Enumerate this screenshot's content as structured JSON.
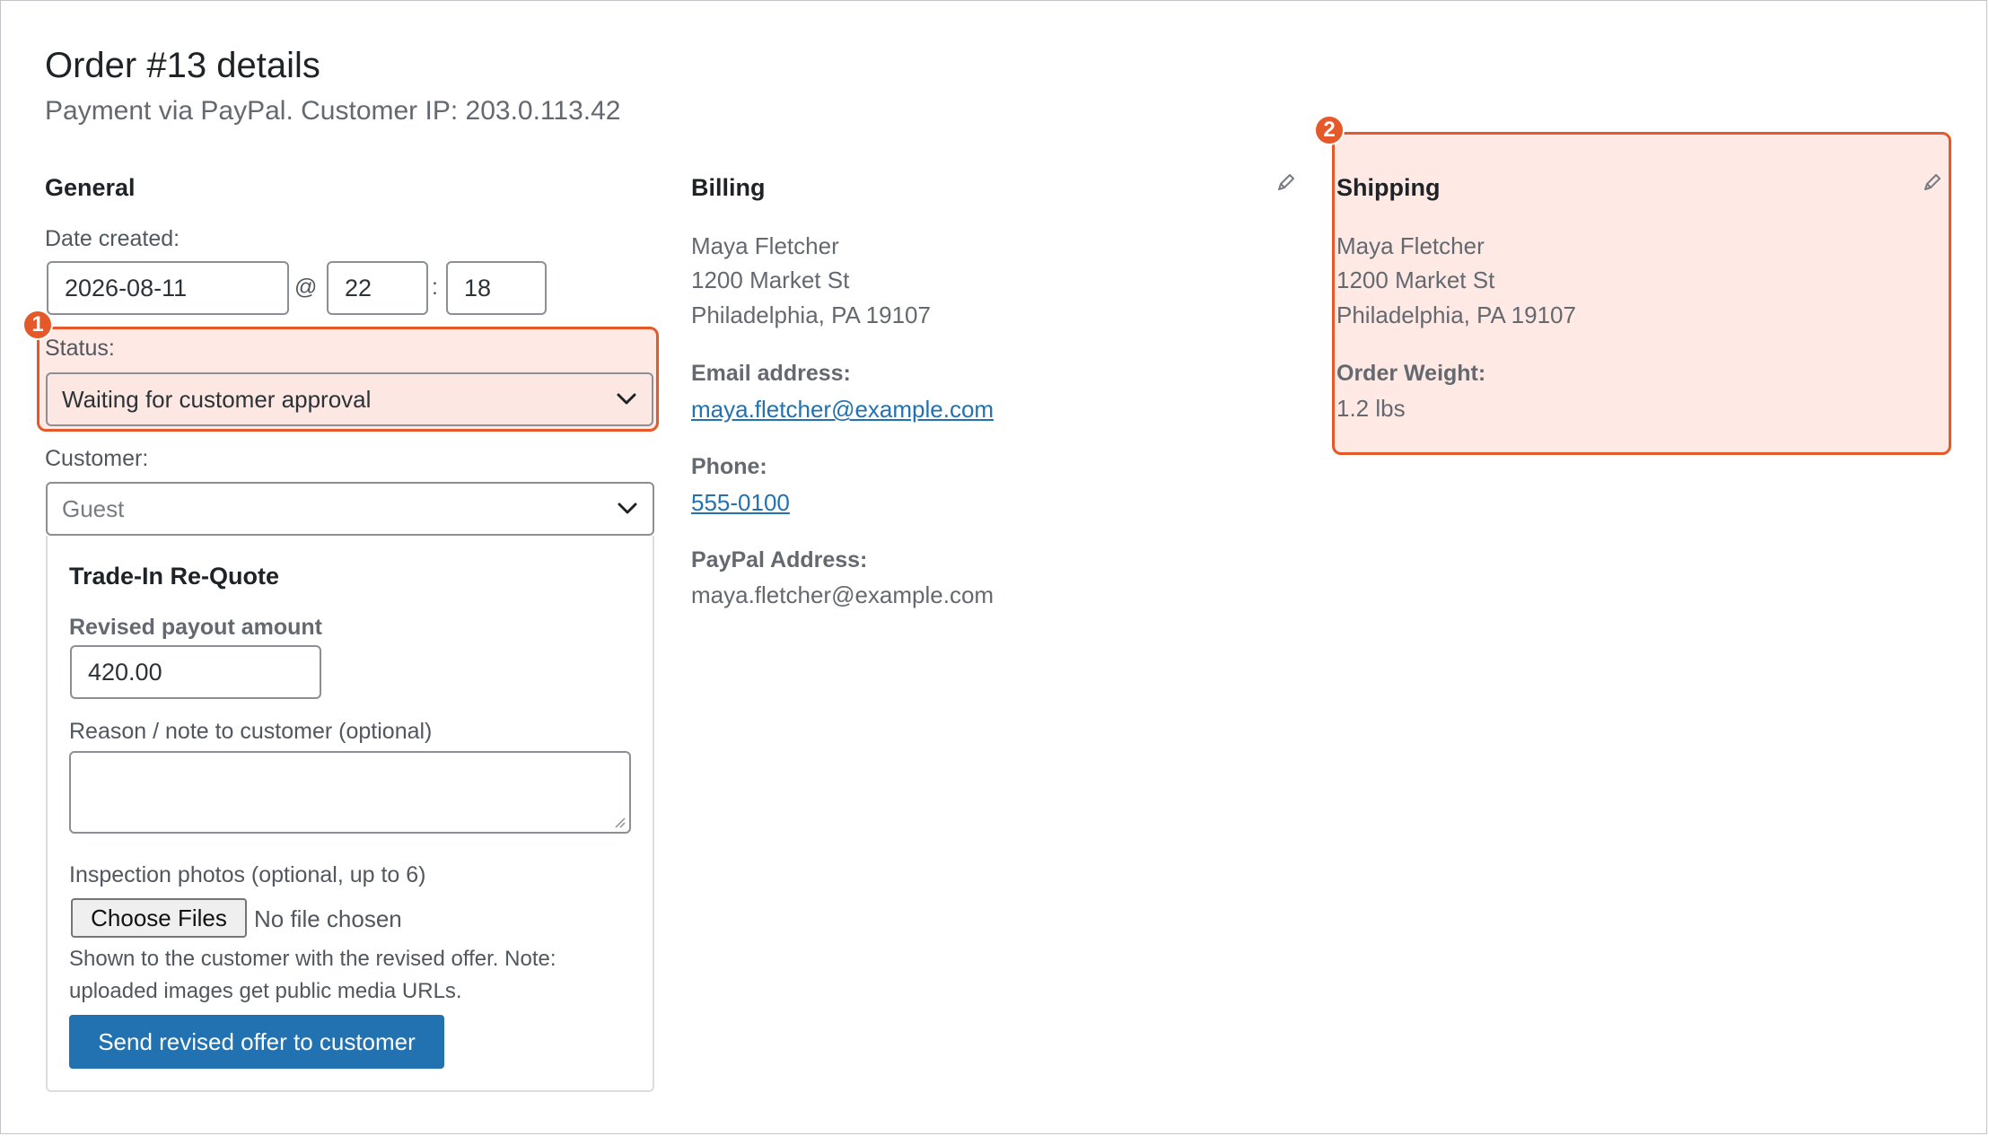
{
  "header": {
    "title": "Order #13 details",
    "subtitle": "Payment via PayPal. Customer IP: 203.0.113.42"
  },
  "general": {
    "heading": "General",
    "date_label": "Date created:",
    "date_value": "2026-08-11",
    "at_sep": "@",
    "hour_value": "22",
    "colon_sep": ":",
    "minute_value": "18",
    "status_label": "Status:",
    "status_value": "Waiting for customer approval",
    "customer_label": "Customer:",
    "customer_value": "Guest"
  },
  "requote": {
    "heading": "Trade-In Re-Quote",
    "payout_label": "Revised payout amount",
    "payout_value": "420.00",
    "note_label": "Reason / note to customer (optional)",
    "note_value": "",
    "photos_label": "Inspection photos (optional, up to 6)",
    "choose_files_label": "Choose Files",
    "no_file_text": "No file chosen",
    "help_text": "Shown to the customer with the revised offer. Note: uploaded images get public media URLs.",
    "send_button_label": "Send revised offer to customer"
  },
  "billing": {
    "heading": "Billing",
    "name": "Maya Fletcher",
    "street": "1200 Market St",
    "city": "Philadelphia, PA 19107",
    "email_label": "Email address:",
    "email": "maya.fletcher@example.com",
    "phone_label": "Phone:",
    "phone": "555-0100",
    "paypal_label": "PayPal Address:",
    "paypal": "maya.fletcher@example.com"
  },
  "shipping": {
    "heading": "Shipping",
    "name": "Maya Fletcher",
    "street": "1200 Market St",
    "city": "Philadelphia, PA 19107",
    "weight_label": "Order Weight:",
    "weight": "1.2 lbs"
  },
  "callouts": {
    "one": "1",
    "two": "2"
  },
  "colors": {
    "highlight_border": "#e5582a",
    "highlight_fill": "#fde2dc",
    "primary_button": "#2271b1",
    "link": "#2271b1"
  }
}
